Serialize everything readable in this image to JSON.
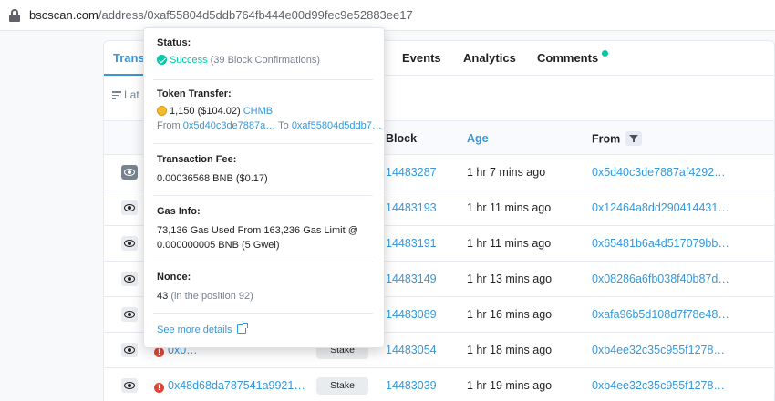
{
  "browser": {
    "url_host": "bscscan.com",
    "url_path": "/address/0xaf55804d5ddb764fb444e00d99fec9e52883ee17"
  },
  "tabs": [
    {
      "label": "Trans"
    },
    {
      "label": "Events"
    },
    {
      "label": "Analytics"
    },
    {
      "label": "Comments"
    }
  ],
  "latest_label": "Lat",
  "columns": {
    "block": "Block",
    "age": "Age",
    "from": "From"
  },
  "rows": [
    {
      "block": "14483287",
      "age": "1 hr 7 mins ago",
      "from": "0x5d40c3de7887af4292…"
    },
    {
      "block": "14483193",
      "age": "1 hr 11 mins ago",
      "from": "0x12464a8dd290414431…"
    },
    {
      "block": "14483191",
      "age": "1 hr 11 mins ago",
      "from": "0x65481b6a4d517079bb…"
    },
    {
      "block": "14483149",
      "age": "1 hr 13 mins ago",
      "from": "0x08286a6fb038f40b87d…"
    },
    {
      "block": "14483089",
      "age": "1 hr 16 mins ago",
      "from": "0xafa96b5d108d7f78e48…"
    },
    {
      "block": "14483054",
      "age": "1 hr 18 mins ago",
      "from": "0xb4ee32c35c955f1278…",
      "txn": "0x0…",
      "method": "Stake"
    },
    {
      "block": "14483039",
      "age": "1 hr 19 mins ago",
      "from": "0xb4ee32c35c955f1278…",
      "txn": "0x48d68da787541a9921…",
      "method": "Stake"
    }
  ],
  "popover": {
    "status_title": "Status:",
    "status_value": "Success",
    "status_confirmations": "(39 Block Confirmations)",
    "token_title": "Token Transfer:",
    "token_amount": "1,150 ($104.02)",
    "token_symbol": "CHMB",
    "from_label": "From",
    "from_addr": "0x5d40c3de7887a…",
    "to_label": "To",
    "to_addr": "0xaf55804d5ddb7…",
    "fee_title": "Transaction Fee:",
    "fee_value": "0.00036568 BNB ($0.17)",
    "gas_title": "Gas Info:",
    "gas_line1": "73,136 Gas Used From 163,236 Gas Limit @",
    "gas_line2": "0.000000005 BNB (5 Gwei)",
    "nonce_title": "Nonce:",
    "nonce_value": "43",
    "nonce_position": "(in the position 92)",
    "more_details": "See more details"
  }
}
